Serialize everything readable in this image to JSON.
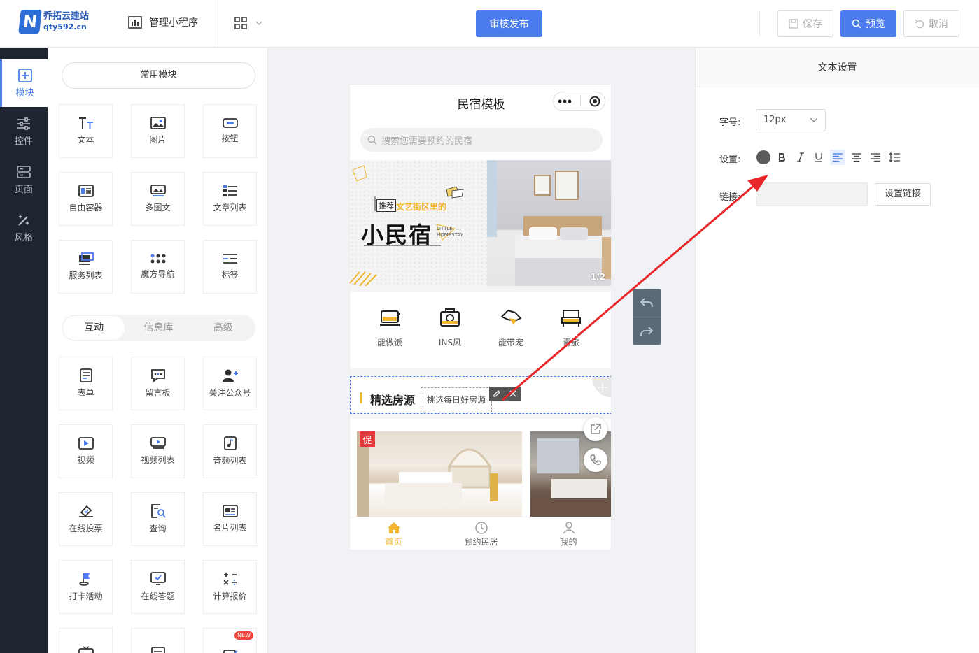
{
  "topbar": {
    "logo_name": "乔拓云建站",
    "logo_url": "qty592.cn",
    "logo_letter": "N",
    "manage_label": "管理小程序",
    "publish_label": "审核发布",
    "save_label": "保存",
    "preview_label": "预览",
    "cancel_label": "取消"
  },
  "leftnav": {
    "items": [
      {
        "label": "模块",
        "icon": "plus-square-icon",
        "active": true
      },
      {
        "label": "控件",
        "icon": "sliders-icon"
      },
      {
        "label": "页面",
        "icon": "layers-icon"
      },
      {
        "label": "风格",
        "icon": "magic-wand-icon"
      }
    ]
  },
  "modules": {
    "common_label": "常用模块",
    "common": [
      {
        "label": "文本",
        "icon": "text-icon"
      },
      {
        "label": "图片",
        "icon": "image-icon"
      },
      {
        "label": "按钮",
        "icon": "button-icon"
      },
      {
        "label": "自由容器",
        "icon": "container-icon"
      },
      {
        "label": "多图文",
        "icon": "multi-image-icon"
      },
      {
        "label": "文章列表",
        "icon": "article-list-icon"
      },
      {
        "label": "服务列表",
        "icon": "service-list-icon"
      },
      {
        "label": "魔方导航",
        "icon": "dots-grid-icon"
      },
      {
        "label": "标签",
        "icon": "tag-icon"
      }
    ],
    "tabs": [
      "互动",
      "信息库",
      "高级"
    ],
    "interactive": [
      {
        "label": "表单",
        "icon": "form-icon"
      },
      {
        "label": "留言板",
        "icon": "message-icon"
      },
      {
        "label": "关注公众号",
        "icon": "follow-user-icon"
      },
      {
        "label": "视频",
        "icon": "video-icon"
      },
      {
        "label": "视频列表",
        "icon": "video-list-icon"
      },
      {
        "label": "音频列表",
        "icon": "audio-icon"
      },
      {
        "label": "在线投票",
        "icon": "vote-icon"
      },
      {
        "label": "查询",
        "icon": "query-icon"
      },
      {
        "label": "名片列表",
        "icon": "card-icon"
      },
      {
        "label": "打卡活动",
        "icon": "flag-icon"
      },
      {
        "label": "在线答题",
        "icon": "quiz-icon"
      },
      {
        "label": "计算报价",
        "icon": "calculator-icon"
      }
    ],
    "new_badge": "NEW"
  },
  "phone": {
    "title": "民宿模板",
    "search_placeholder": "搜索您需要预约的民宿",
    "banner": {
      "tag": "推荐",
      "subtitle": "文艺街区里的",
      "title": "小民宿",
      "little": "LITTLE",
      "homestay": "HOMESTAY",
      "pager": "1/2"
    },
    "categories": [
      {
        "label": "能做饭",
        "icon": "cooking-icon"
      },
      {
        "label": "INS风",
        "icon": "camera-icon"
      },
      {
        "label": "能带宠",
        "icon": "pet-icon"
      },
      {
        "label": "青旅",
        "icon": "bed-icon"
      }
    ],
    "section_title": "精选房源",
    "section_sub": "挑选每日好房源",
    "promo": "促",
    "tabbar": [
      {
        "label": "首页",
        "icon": "home-icon",
        "active": true
      },
      {
        "label": "预约民居",
        "icon": "clock-icon"
      },
      {
        "label": "我的",
        "icon": "user-icon"
      }
    ]
  },
  "settings": {
    "header": "文本设置",
    "font_size_label": "字号:",
    "font_size_value": "12px",
    "style_label": "设置:",
    "link_label": "链接:",
    "link_button": "设置链接",
    "text_color": "#5b5b5b"
  },
  "colors": {
    "accent": "#4b7bec",
    "dark_nav": "#1f2530",
    "yellow": "#f2b52e",
    "arrow": "#e8262a"
  }
}
